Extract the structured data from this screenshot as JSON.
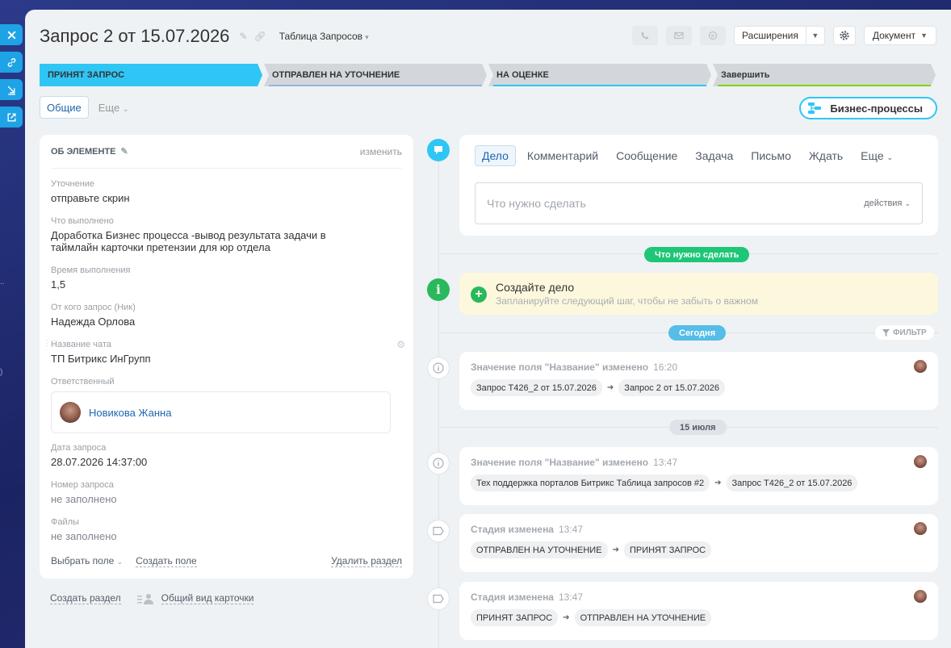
{
  "header": {
    "title": "Запрос 2 от 15.07.2026",
    "category": "Таблица Запросов",
    "extensions_label": "Расширения",
    "document_label": "Документ"
  },
  "stages": [
    {
      "label": "ПРИНЯТ ЗАПРОС",
      "color": "#2fc6f6",
      "active": true
    },
    {
      "label": "ОТПРАВЛЕН НА УТОЧНЕНИЕ",
      "color": "#d3d7dc",
      "underline": "#9ab3dd"
    },
    {
      "label": "НА ОЦЕНКЕ",
      "color": "#d3d7dc",
      "underline": "#2fc6f6"
    },
    {
      "label": "Завершить",
      "color": "#d3d7dc",
      "underline": "#7bd500"
    }
  ],
  "tabs": {
    "main": "Общие",
    "more": "Еще"
  },
  "bp_button": "Бизнес-процессы",
  "card": {
    "title": "ОБ ЭЛЕМЕНТЕ",
    "edit": "изменить",
    "fields": [
      {
        "label": "Уточнение",
        "value": "отправьте скрин"
      },
      {
        "label": "Что выполнено",
        "value": "Доработка Бизнес процесса -вывод результата задачи в таймлайн карточки претензии для юр отдела"
      },
      {
        "label": "Время выполнения",
        "value": "1,5"
      },
      {
        "label": "От кого запрос (Ник)",
        "value": "Надежда Орлова"
      },
      {
        "label": "Название чата",
        "value": "ТП Битрикс ИнГрупп"
      },
      {
        "label": "Ответственный",
        "value": "Новикова Жанна"
      },
      {
        "label": "Дата запроса",
        "value": "28.07.2026 14:37:00"
      },
      {
        "label": "Номер запроса",
        "value": "не заполнено"
      },
      {
        "label": "Файлы",
        "value": "не заполнено"
      }
    ],
    "footer": {
      "choose_field": "Выбрать поле",
      "create_field": "Создать поле",
      "delete_section": "Удалить раздел"
    }
  },
  "below_card": {
    "create_section": "Создать раздел",
    "common_view": "Общий вид карточки"
  },
  "editor": {
    "tabs": [
      "Дело",
      "Комментарий",
      "Сообщение",
      "Задача",
      "Письмо",
      "Ждать",
      "Еще"
    ],
    "placeholder": "Что нужно сделать",
    "actions": "действия"
  },
  "timeline": {
    "todo_pill": "Что нужно сделать",
    "todo_title": "Создайте дело",
    "todo_sub": "Запланируйте следующий шаг, чтобы не забыть о важном",
    "today_pill": "Сегодня",
    "filter": "ФИЛЬТР",
    "date_pill": "15 июля",
    "events": [
      {
        "title": "Значение поля \"Название\" изменено",
        "time": "16:20",
        "from": "Запрос T426_2 от 15.07.2026",
        "to": "Запрос 2 от 15.07.2026"
      },
      {
        "title": "Значение поля \"Название\" изменено",
        "time": "13:47",
        "from": "Тех поддержка порталов Битрикс Таблица запросов #2",
        "to": "Запрос T426_2 от 15.07.2026"
      },
      {
        "title": "Стадия изменена",
        "time": "13:47",
        "from": "ОТПРАВЛЕН НА УТОЧНЕНИЕ",
        "to": "ПРИНЯТ ЗАПРОС"
      },
      {
        "title": "Стадия изменена",
        "time": "13:47",
        "from": "ПРИНЯТ ЗАПРОС",
        "to": "ОТПРАВЛЕН НА УТОЧНЕНИЕ"
      }
    ]
  }
}
